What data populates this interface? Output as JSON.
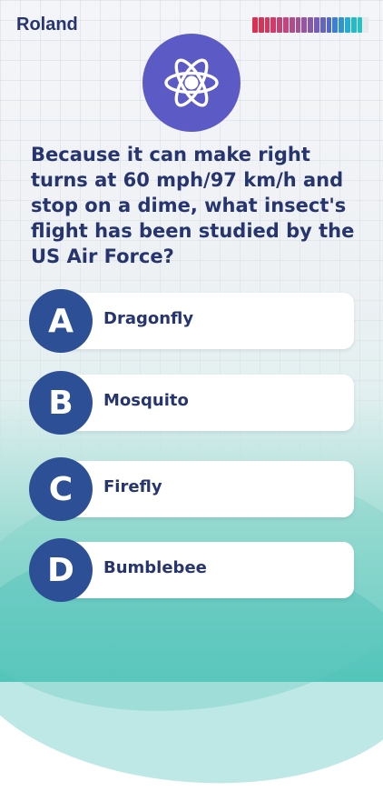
{
  "header": {
    "player_name": "Roland",
    "timer": {
      "remaining_fraction": 0.94,
      "tick_colors": [
        "#d9314f",
        "#d93456",
        "#d5385f",
        "#cf3c69",
        "#c84173",
        "#bf467e",
        "#b34b89",
        "#a55093",
        "#9755a0",
        "#8759ac",
        "#765eb7",
        "#6563c2",
        "#5468c9",
        "#3f7fcf",
        "#2f95cf",
        "#27acd0",
        "#21bccc",
        "#22c3c4",
        "#e8e8ec"
      ]
    }
  },
  "category": {
    "icon": "atom-icon",
    "color": "#5c5bc5"
  },
  "question": {
    "text": "Because it can make right turns at 60 mph/97 km/h and stop on a dime, what insect's flight has been studied by the US Air Force?"
  },
  "answers": [
    {
      "letter": "A",
      "label": "Dragonfly"
    },
    {
      "letter": "B",
      "label": "Mosquito"
    },
    {
      "letter": "C",
      "label": "Firefly"
    },
    {
      "letter": "D",
      "label": "Bumblebee"
    }
  ],
  "colors": {
    "text": "#26356e",
    "letter_circle": "#2d4f95",
    "answer_bg": "#ffffff"
  }
}
